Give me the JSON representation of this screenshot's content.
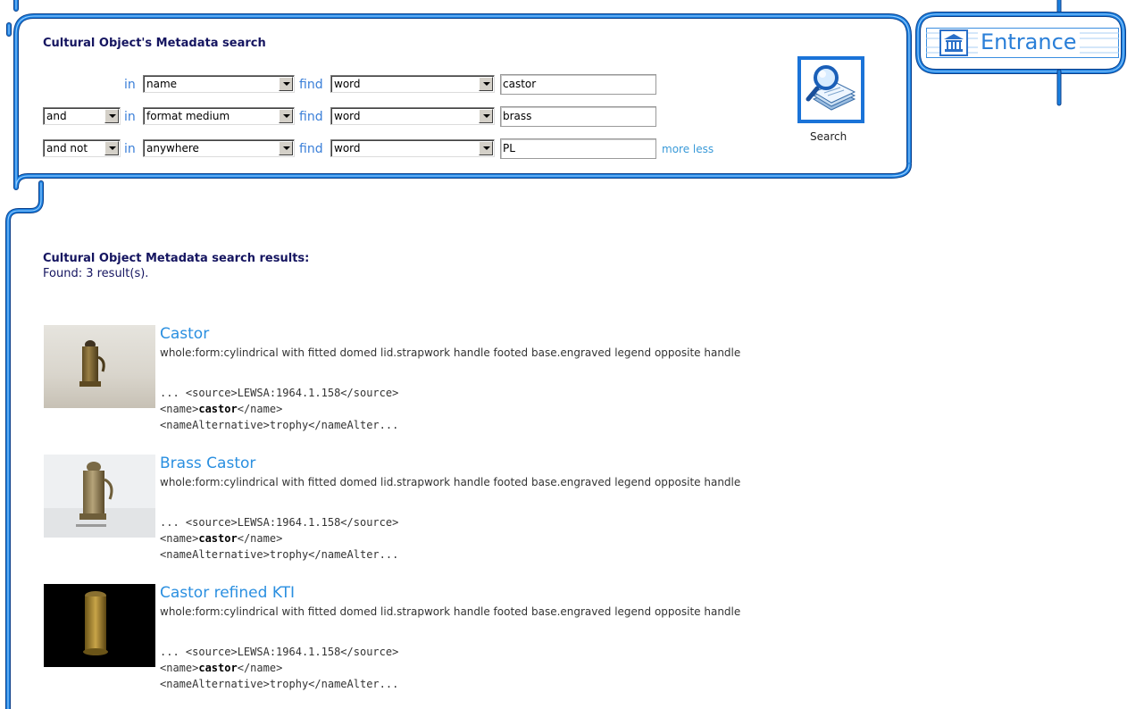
{
  "search_panel": {
    "title": "Cultural Object's Metadata search",
    "rows": [
      {
        "op": "",
        "in_label": "in",
        "field": "name",
        "find_label": "find",
        "match": "word",
        "value": "castor"
      },
      {
        "op": "and",
        "in_label": "in",
        "field": "format medium",
        "find_label": "find",
        "match": "word",
        "value": "brass"
      },
      {
        "op": "and not",
        "in_label": "in",
        "field": "anywhere",
        "find_label": "find",
        "match": "word",
        "value": "PL"
      }
    ],
    "more_label": "more",
    "less_label": "less",
    "search_button_label": "Search",
    "search_icon": "magnifier-documents-icon"
  },
  "entrance": {
    "label": "Entrance",
    "icon": "museum-building-icon"
  },
  "results": {
    "title": "Cultural Object Metadata search results:",
    "count_text": "Found: 3 result(s).",
    "items": [
      {
        "title": "Castor",
        "description": "whole:form:cylindrical with fitted domed lid.strapwork handle footed base.engraved legend opposite handle",
        "snippet_line1": "... <source>LEWSA:1964.1.158</source>",
        "snippet_line2_pre": "<name>",
        "snippet_line2_bold": "castor",
        "snippet_line2_post": "</name>",
        "snippet_line3": "<nameAlternative>trophy</nameAlter...",
        "thumbnail": "brass-castor-photo"
      },
      {
        "title": "Brass Castor",
        "description": "whole:form:cylindrical with fitted domed lid.strapwork handle footed base.engraved legend opposite handle",
        "snippet_line1": "... <source>LEWSA:1964.1.158</source>",
        "snippet_line2_pre": "<name>",
        "snippet_line2_bold": "castor",
        "snippet_line2_post": "</name>",
        "snippet_line3": "<nameAlternative>trophy</nameAlter...",
        "thumbnail": "brass-castor-photo-white-background"
      },
      {
        "title": "Castor refined KTI",
        "description": "whole:form:cylindrical with fitted domed lid.strapwork handle footed base.engraved legend opposite handle",
        "snippet_line1": "... <source>LEWSA:1964.1.158</source>",
        "snippet_line2_pre": "<name>",
        "snippet_line2_bold": "castor",
        "snippet_line2_post": "</name>",
        "snippet_line3": "<nameAlternative>trophy</nameAlter...",
        "thumbnail": "castor-3d-render-black-background"
      }
    ]
  },
  "colors": {
    "frame_blue": "#1a73d8",
    "link_blue": "#2a8fe0",
    "title_navy": "#151560"
  }
}
